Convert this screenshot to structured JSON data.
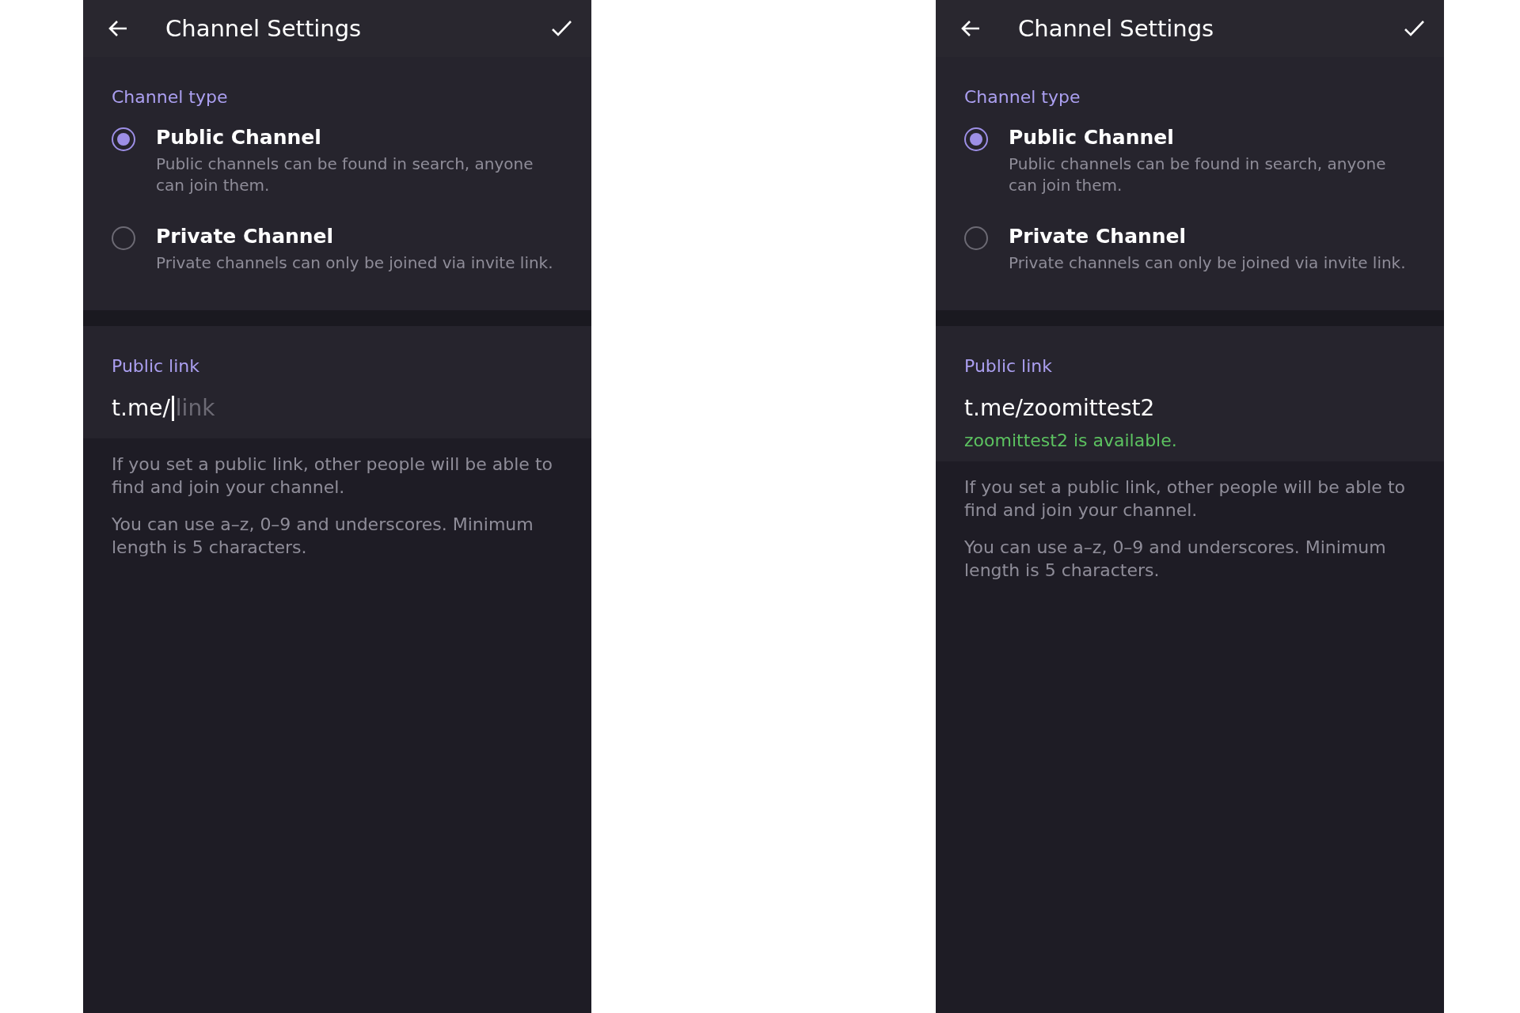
{
  "panels": [
    {
      "title": "Channel Settings",
      "channel_type": {
        "title": "Channel type",
        "options": [
          {
            "label": "Public Channel",
            "description": "Public channels can be found in search, anyone can join them.",
            "selected": true
          },
          {
            "label": "Private Channel",
            "description": "Private channels can only be joined via invite link.",
            "selected": false
          }
        ]
      },
      "public_link": {
        "title": "Public link",
        "prefix": "t.me/",
        "placeholder": "link",
        "focused": true
      },
      "notes": [
        "If you set a public link, other people will be able to find and join your channel.",
        "You can use a–z, 0–9 and underscores. Minimum length is 5 characters."
      ]
    },
    {
      "title": "Channel Settings",
      "channel_type": {
        "title": "Channel type",
        "options": [
          {
            "label": "Public Channel",
            "description": "Public channels can be found in search, anyone can join them.",
            "selected": true
          },
          {
            "label": "Private Channel",
            "description": "Private channels can only be joined via invite link.",
            "selected": false
          }
        ]
      },
      "public_link": {
        "title": "Public link",
        "prefix": "t.me/",
        "value": "zoomittest2",
        "focused": false,
        "status": "zoomittest2 is available."
      },
      "notes": [
        "If you set a public link, other people will be able to find and join your channel.",
        "You can use a–z, 0–9 and underscores. Minimum length is 5 characters."
      ]
    }
  ]
}
